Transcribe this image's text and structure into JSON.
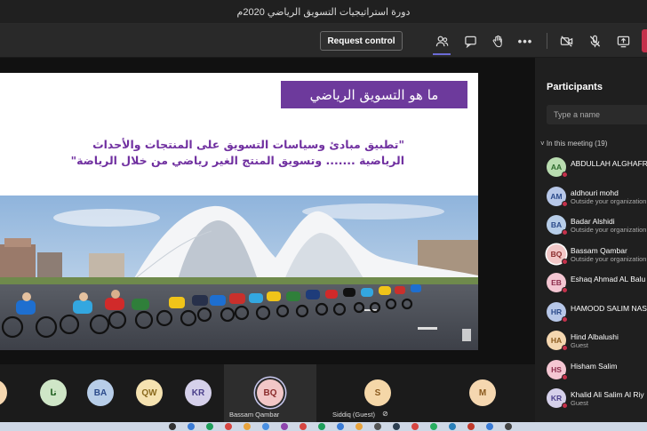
{
  "window": {
    "title": "دورة استراتيجيات التسويق الرياضي 2020م"
  },
  "toolbar": {
    "request_control": "Request control",
    "icons": [
      "participants-icon",
      "chat-icon",
      "raise-hand-icon",
      "more-options-icon",
      "camera-off-icon",
      "mic-off-icon",
      "share-screen-icon",
      "leave-icon"
    ]
  },
  "slide": {
    "title": "ما هو التسويق الرياضي",
    "line1": "\"تطبيق مبادئ وسياسات التسويق على المنتجات والأحداث",
    "line2": "الرياضية ....... وتسويق المنتج الغير رياضي من خلال الرياضة\""
  },
  "participants": {
    "title": "Participants",
    "search_placeholder": "Type a name",
    "section": "In this meeting (19)",
    "list": [
      {
        "initials": "AA",
        "name": "ABDULLAH ALGHAFR",
        "sub": "",
        "avatar_bg": "#b9dcb0",
        "avatar_fg": "#2d6a2d",
        "status": "#c4314b"
      },
      {
        "initials": "AM",
        "name": "aldhouri mohd",
        "sub": "Outside your organization",
        "avatar_bg": "#b7c7e8",
        "avatar_fg": "#2b4a8a",
        "status": "#c4314b"
      },
      {
        "initials": "BA",
        "name": "Badar Alshidi",
        "sub": "Outside your organization",
        "avatar_bg": "#b7cde8",
        "avatar_fg": "#2b4a8a",
        "status": "#c4314b"
      },
      {
        "initials": "BQ",
        "name": "Bassam Qambar",
        "sub": "Outside your organization",
        "avatar_bg": "#f2c7c7",
        "avatar_fg": "#8a2b2b",
        "status": "#c4314b"
      },
      {
        "initials": "EB",
        "name": "Eshaq Ahmad AL Balu",
        "sub": "",
        "avatar_bg": "#f4c6d2",
        "avatar_fg": "#8a2b4a",
        "status": "#c4314b"
      },
      {
        "initials": "HR",
        "name": "HAMOOD SALIM NAS",
        "sub": "",
        "avatar_bg": "#b7c7e8",
        "avatar_fg": "#2b4a8a",
        "status": "#c4314b"
      },
      {
        "initials": "HA",
        "name": "Hind Albalushi",
        "sub": "Guest",
        "avatar_bg": "#f5d7b0",
        "avatar_fg": "#8a5a1e",
        "status": "#c4314b"
      },
      {
        "initials": "HS",
        "name": "Hisham Salim",
        "sub": "",
        "avatar_bg": "#f4c6d2",
        "avatar_fg": "#8a2b4a",
        "status": "#c4314b"
      },
      {
        "initials": "KR",
        "name": "Khalid Ali Salim Al Riy",
        "sub": "Guest",
        "avatar_bg": "#d5d0ea",
        "avatar_fg": "#4a3f8a",
        "status": "#c4314b"
      }
    ]
  },
  "gallery": {
    "tiles": [
      {
        "initials": "س",
        "name": "",
        "avatar_bg": "#f5d7b0",
        "avatar_fg": "#8a5a1e"
      },
      {
        "initials": "تا",
        "name": "",
        "avatar_bg": "#cfe6c7",
        "avatar_fg": "#2d6a2d"
      },
      {
        "initials": "BA",
        "name": "",
        "avatar_bg": "#b7cde8",
        "avatar_fg": "#2b4a8a"
      },
      {
        "initials": "QW",
        "name": "",
        "avatar_bg": "#f5e2b0",
        "avatar_fg": "#8a6a1e"
      },
      {
        "initials": "KR",
        "name": "",
        "avatar_bg": "#d5d0ea",
        "avatar_fg": "#4a3f8a"
      },
      {
        "initials": "BQ",
        "name": "Bassam Qambar",
        "avatar_bg": "#f2c7c7",
        "avatar_fg": "#8a2b2b"
      },
      {
        "initials": "S",
        "name": "Siddiq (Guest)",
        "avatar_bg": "#f5d7a8",
        "avatar_fg": "#8a5a1e"
      },
      {
        "initials": "M",
        "name": "",
        "avatar_bg": "#f5d7b0",
        "avatar_fg": "#8a5a1e"
      }
    ]
  },
  "colors": {
    "accent": "#6264a7",
    "slide_purple": "#6d3a9c",
    "busy_red": "#c4314b"
  }
}
